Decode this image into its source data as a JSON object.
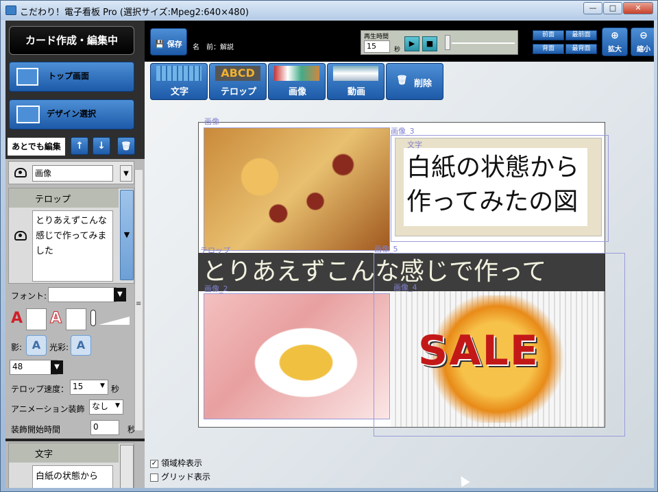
{
  "window": {
    "title": "こだわり！電子看板 Pro (選択サイズ:Mpeg2:640×480)",
    "min": "—",
    "max": "□",
    "close": "✕"
  },
  "left": {
    "mode": "カード作成・編集中",
    "top_btn": "トップ画面",
    "design_btn": "デザイン選択",
    "edit_label": "あとでも編集",
    "up": "↑",
    "down": "↓",
    "trash": "🗑",
    "layer1": {
      "name": "画像"
    },
    "layer2": {
      "title": "テロップ",
      "text": "とりあえずこんな感じで作ってみました"
    },
    "font_label": "フォント:",
    "shadow_label": "影:",
    "glow_label": "光彩:",
    "font_size": "48",
    "speed_label": "テロップ速度：",
    "speed_value": "15",
    "speed_unit": "秒",
    "anim_label": "アニメーション装飾",
    "anim_value": "なし",
    "deco_label": "装飾開始時間",
    "deco_value": "0",
    "deco_unit": "秒",
    "layer3": {
      "title": "文字",
      "text": "白紙の状態から"
    }
  },
  "toolbar": {
    "save": "保存",
    "name_label": "名　前：解説",
    "play_label": "再生時間",
    "play_value": "15",
    "play_unit": "秒",
    "front": "前面",
    "frontmost": "最前面",
    "back": "背面",
    "backmost": "最背面",
    "zoom_in": "拡大",
    "zoom_out": "縮小"
  },
  "elements": {
    "text": "文字",
    "telop": "テロップ",
    "image": "画像",
    "video": "動画",
    "delete": "削除"
  },
  "card": {
    "label_img1": "画像",
    "label_img3": "画像_3",
    "label_text": "文字",
    "label_telop": "テロップ",
    "label_img5": "画像_5",
    "label_img_low": "画像_4",
    "label_img2": "画像_2",
    "text_content": "白紙の状態から作ってみたの図",
    "telop_text": "とりあえずこんな感じで作って",
    "sale": "SALE"
  },
  "options": {
    "frame": "領域枠表示",
    "grid": "グリッド表示"
  }
}
